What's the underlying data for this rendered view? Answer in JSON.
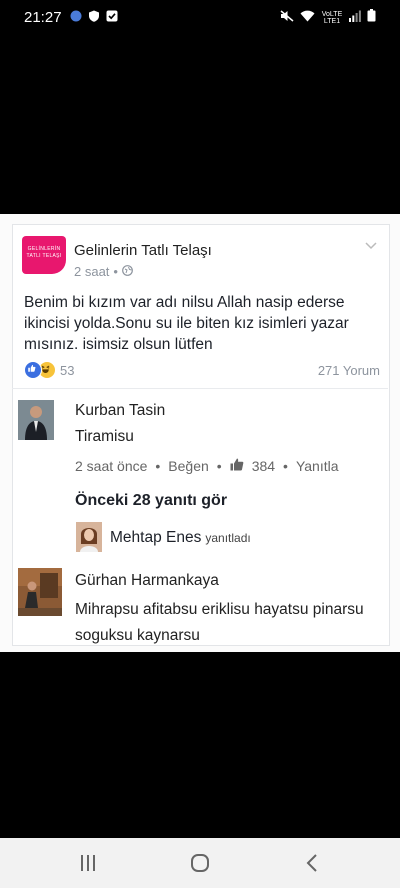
{
  "status_bar": {
    "time": "21:27",
    "network_label": "VoLTE LTE1"
  },
  "post": {
    "page_logo_text": "GELİNLERİN TATLI TELAŞI",
    "page_name": "Gelinlerin Tatlı Telaşı",
    "time": "2 saat",
    "separator": "•",
    "privacy_icon": "globe-icon",
    "text": "Benim bi kızım var adı nilsu Allah nasip ederse ikincisi yolda.Sonu su ile biten kız isimleri yazar mısınız. isimsiz olsun lütfen",
    "reaction_count": "53",
    "comment_count": "271 Yorum"
  },
  "comments": [
    {
      "name": "Kurban Tasin",
      "text": "Tiramisu",
      "time": "2 saat önce",
      "like_label": "Beğen",
      "like_count": "384",
      "reply_label": "Yanıtla"
    },
    {
      "name": "Gürhan Harmankaya",
      "text": "Mihrapsu afitabsu eriklisu hayatsu pinarsu soguksu kaynarsu"
    }
  ],
  "replies": {
    "see_previous": "Önceki 28 yanıtı gör",
    "last_reply_name": "Mehtap Enes",
    "last_reply_action": "yanıtladı"
  },
  "colors": {
    "accent": "#e8176e",
    "like_blue": "#3b6fe0",
    "haha_yellow": "#f7c33a",
    "meta_gray": "#8d949e"
  }
}
